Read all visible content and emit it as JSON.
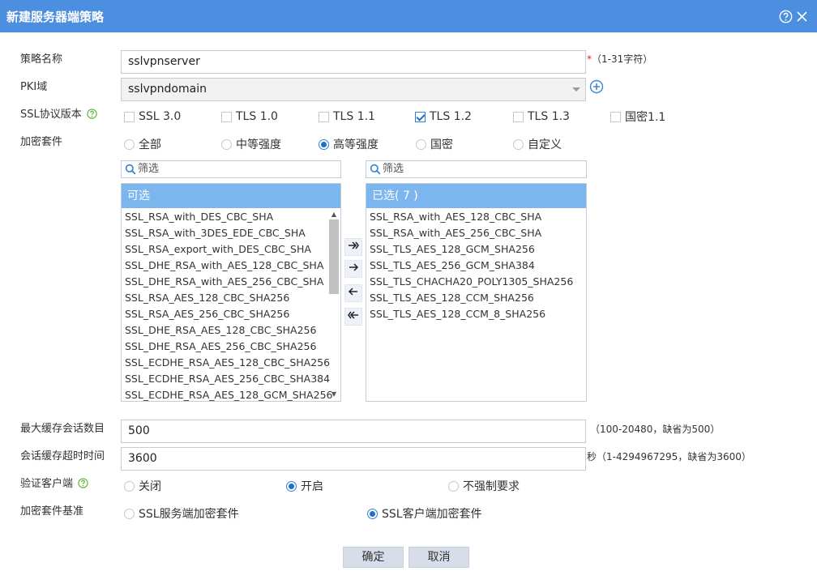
{
  "dialog": {
    "title": "新建服务器端策略"
  },
  "fields": {
    "policy_name_label": "策略名称",
    "policy_name_value": "sslvpnserver",
    "policy_name_req": "*",
    "policy_name_hint": "（1-31字符）",
    "pki_label": "PKI域",
    "pki_value": "sslvpndomain",
    "ssl_version_label": "SSL协议版本",
    "cipher_label": "加密套件",
    "max_cache_label": "最大缓存会话数目",
    "max_cache_value": "500",
    "max_cache_hint": "（100-20480，缺省为500）",
    "cache_timeout_label": "会话缓存超时时间",
    "cache_timeout_value": "3600",
    "cache_timeout_hint": "秒（1-4294967295，缺省为3600）",
    "verify_client_label": "验证客户端",
    "cipher_base_label": "加密套件基准"
  },
  "versions": [
    {
      "label": "SSL 3.0",
      "checked": false
    },
    {
      "label": "TLS 1.0",
      "checked": false
    },
    {
      "label": "TLS 1.1",
      "checked": false
    },
    {
      "label": "TLS 1.2",
      "checked": true
    },
    {
      "label": "TLS 1.3",
      "checked": false
    },
    {
      "label": "国密1.1",
      "checked": false
    }
  ],
  "cipher_strength": [
    {
      "label": "全部",
      "selected": false
    },
    {
      "label": "中等强度",
      "selected": false
    },
    {
      "label": "高等强度",
      "selected": true
    },
    {
      "label": "国密",
      "selected": false
    },
    {
      "label": "自定义",
      "selected": false
    }
  ],
  "filter_placeholder": "筛选",
  "available": {
    "header": "可选",
    "items": [
      "SSL_RSA_with_DES_CBC_SHA",
      "SSL_RSA_with_3DES_EDE_CBC_SHA",
      "SSL_RSA_export_with_DES_CBC_SHA",
      "SSL_DHE_RSA_with_AES_128_CBC_SHA",
      "SSL_DHE_RSA_with_AES_256_CBC_SHA",
      "SSL_RSA_AES_128_CBC_SHA256",
      "SSL_RSA_AES_256_CBC_SHA256",
      "SSL_DHE_RSA_AES_128_CBC_SHA256",
      "SSL_DHE_RSA_AES_256_CBC_SHA256",
      "SSL_ECDHE_RSA_AES_128_CBC_SHA256",
      "SSL_ECDHE_RSA_AES_256_CBC_SHA384",
      "SSL_ECDHE_RSA_AES_128_GCM_SHA256"
    ]
  },
  "selected": {
    "header": "已选( 7 )",
    "items": [
      "SSL_RSA_with_AES_128_CBC_SHA",
      "SSL_RSA_with_AES_256_CBC_SHA",
      "SSL_TLS_AES_128_GCM_SHA256",
      "SSL_TLS_AES_256_GCM_SHA384",
      "SSL_TLS_CHACHA20_POLY1305_SHA256",
      "SSL_TLS_AES_128_CCM_SHA256",
      "SSL_TLS_AES_128_CCM_8_SHA256"
    ]
  },
  "verify_client": [
    {
      "label": "关闭",
      "selected": false
    },
    {
      "label": "开启",
      "selected": true
    },
    {
      "label": "不强制要求",
      "selected": false
    }
  ],
  "cipher_base": [
    {
      "label": "SSL服务端加密套件",
      "selected": false
    },
    {
      "label": "SSL客户端加密套件",
      "selected": true
    }
  ],
  "buttons": {
    "ok": "确定",
    "cancel": "取消"
  },
  "colors": {
    "titlebar": "#4c8ee0",
    "list_header": "#7cb6ee",
    "accent": "#1f6fc9"
  }
}
